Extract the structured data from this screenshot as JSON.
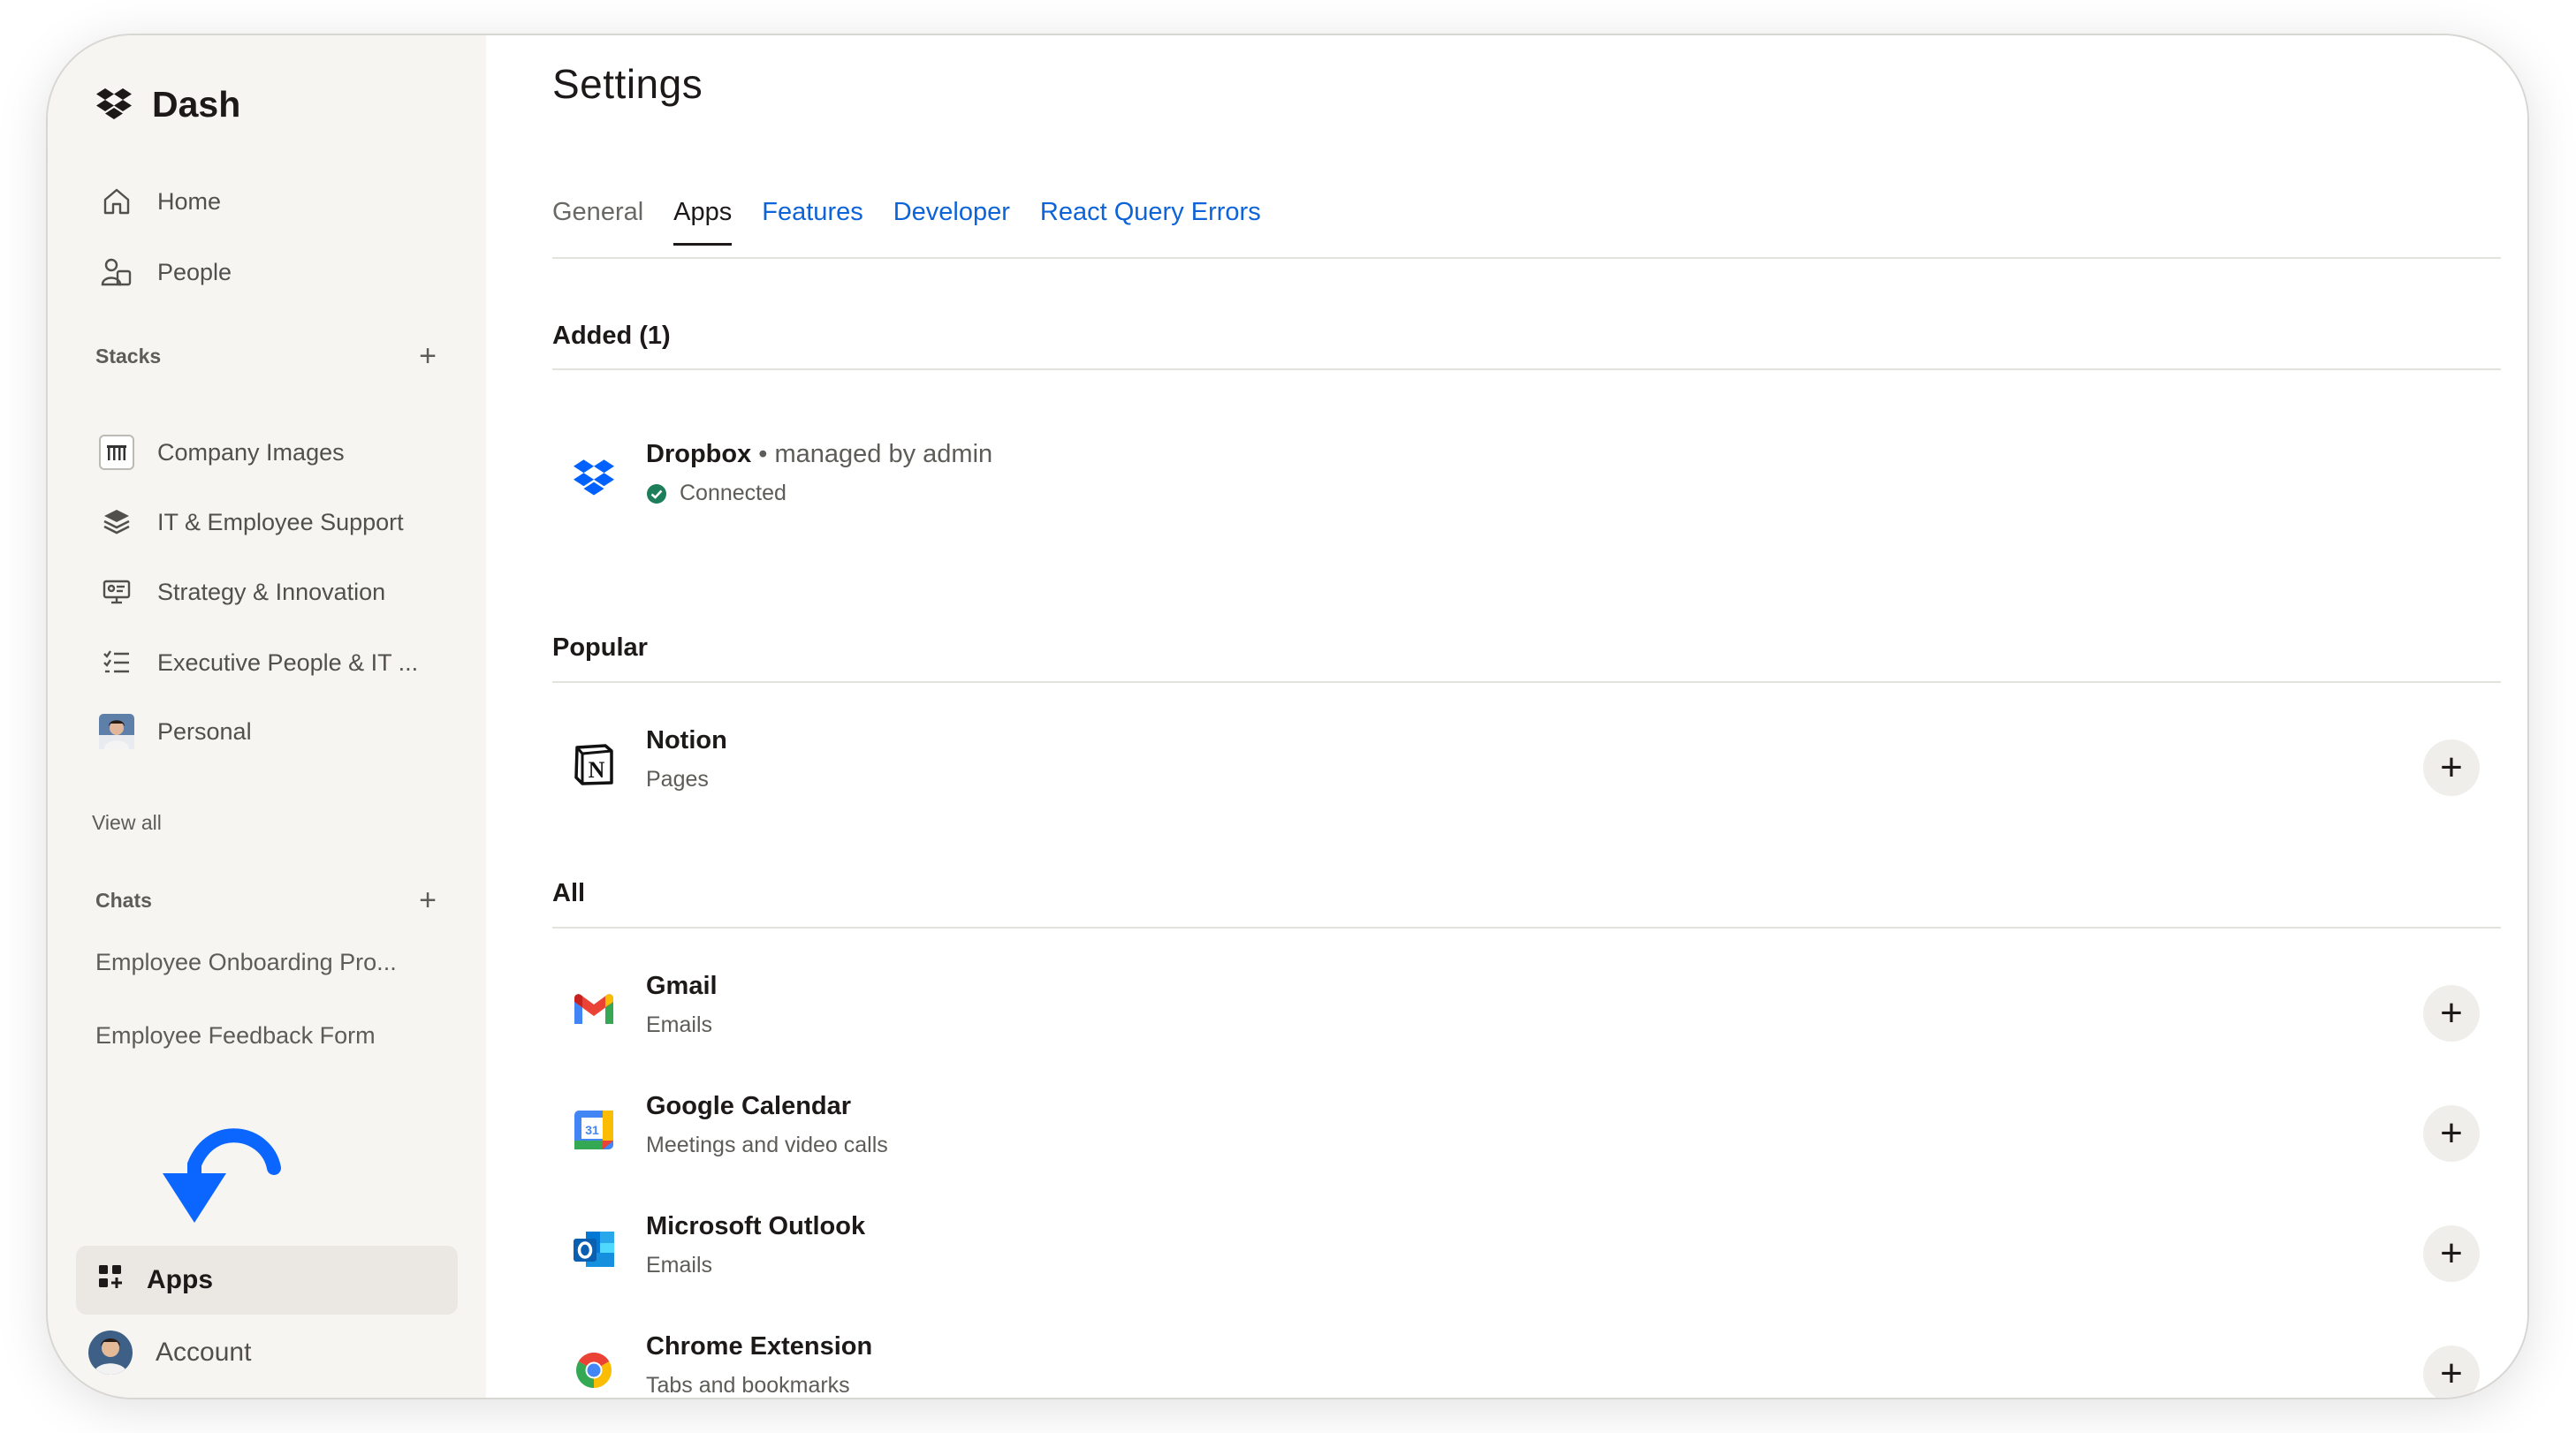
{
  "app": {
    "name": "Dash"
  },
  "sidebar": {
    "nav": [
      {
        "label": "Home",
        "icon": "home-icon"
      },
      {
        "label": "People",
        "icon": "people-icon"
      }
    ],
    "stacks_heading": "Stacks",
    "stacks": [
      {
        "label": "Company Images",
        "icon": "piano-thumbnail-icon"
      },
      {
        "label": "IT & Employee Support",
        "icon": "layers-icon"
      },
      {
        "label": "Strategy & Innovation",
        "icon": "presentation-icon"
      },
      {
        "label": "Executive People & IT ...",
        "icon": "checklist-icon"
      },
      {
        "label": "Personal",
        "icon": "avatar-thumbnail"
      }
    ],
    "view_all": "View all",
    "chats_heading": "Chats",
    "chats": [
      {
        "label": "Employee Onboarding Pro..."
      },
      {
        "label": "Employee Feedback Form"
      }
    ],
    "apps_label": "Apps",
    "account_label": "Account"
  },
  "settings": {
    "title": "Settings",
    "tabs": [
      {
        "label": "General",
        "state": "default"
      },
      {
        "label": "Apps",
        "state": "active"
      },
      {
        "label": "Features",
        "state": "link"
      },
      {
        "label": "Developer",
        "state": "link"
      },
      {
        "label": "React Query Errors",
        "state": "link"
      }
    ],
    "added": {
      "heading": "Added (1)",
      "items": [
        {
          "name": "Dropbox",
          "meta": "• managed by admin",
          "status": "Connected",
          "status_color": "#1e7e5a",
          "icon": "dropbox-icon"
        }
      ]
    },
    "popular": {
      "heading": "Popular",
      "items": [
        {
          "name": "Notion",
          "desc": "Pages",
          "icon": "notion-icon"
        }
      ]
    },
    "all": {
      "heading": "All",
      "items": [
        {
          "name": "Gmail",
          "desc": "Emails",
          "icon": "gmail-icon"
        },
        {
          "name": "Google Calendar",
          "desc": "Meetings and video calls",
          "icon": "google-calendar-icon",
          "badge": "31"
        },
        {
          "name": "Microsoft Outlook",
          "desc": "Emails",
          "icon": "outlook-icon"
        },
        {
          "name": "Chrome Extension",
          "desc": "Tabs and bookmarks",
          "icon": "chrome-icon"
        }
      ]
    },
    "add_glyph": "+"
  },
  "colors": {
    "accent_link": "#0d63d8",
    "dropbox_blue": "#0061fe",
    "sidebar_bg": "#f7f5f2",
    "active_bg": "#ebe8e3"
  }
}
